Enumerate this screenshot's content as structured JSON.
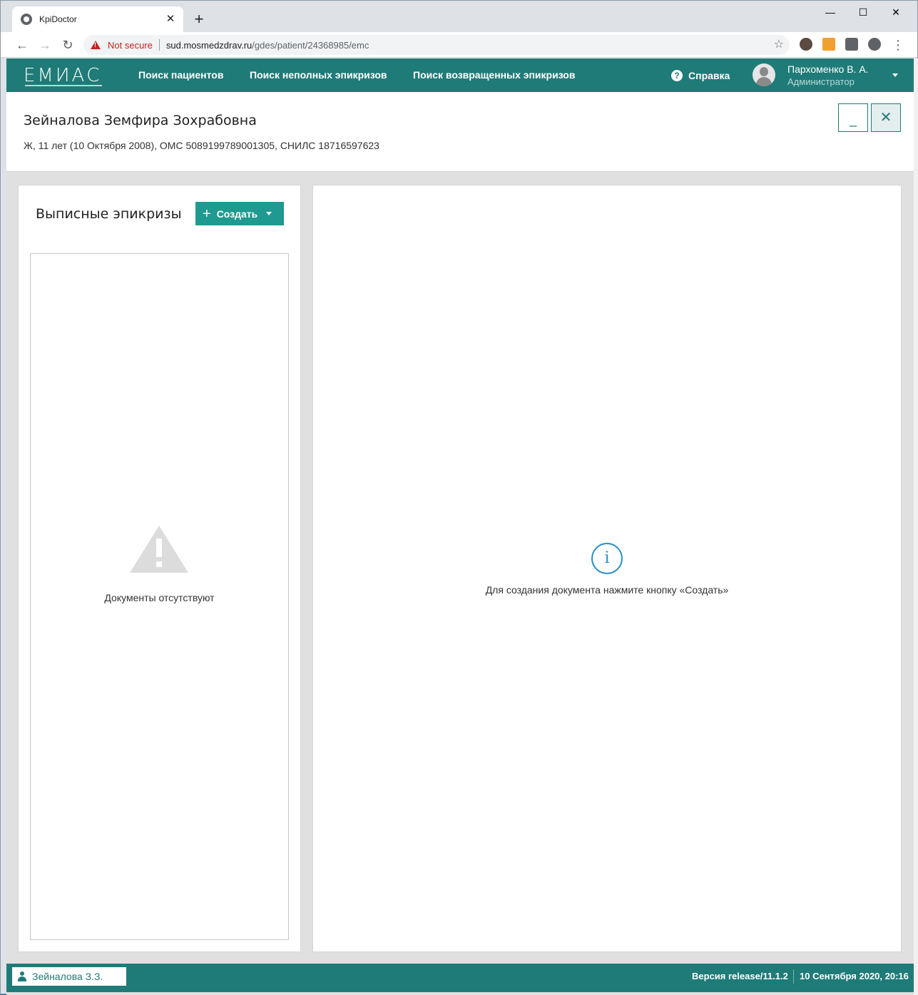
{
  "browser": {
    "tab_title": "KpiDoctor",
    "tab_close": "✕",
    "new_tab": "+",
    "minimize": "—",
    "maximize": "☐",
    "close": "✕",
    "security_label": "Not secure",
    "url_host": "sud.mosmedzdrav.ru",
    "url_path": "/gdes/patient/24368985/emc"
  },
  "appbar": {
    "logo": "ЕМИАС",
    "nav": [
      {
        "label": "Поиск пациентов"
      },
      {
        "label": "Поиск неполных эпикризов"
      },
      {
        "label": "Поиск возвращенных эпикризов"
      }
    ],
    "help_label": "Справка",
    "user_name": "Пархоменко В. А.",
    "user_role": "Администратор",
    "accent_color": "#1f7b78"
  },
  "patient": {
    "name": "Зейналова Земфира Зохрабовна",
    "info": "Ж, 11 лет (10 Октября 2008), ОМС 5089199789001305, СНИЛС 18716597623",
    "minimize_label": "_",
    "close_label": "✕"
  },
  "left_panel": {
    "title": "Выписные эпикризы",
    "create_label": "Создать",
    "empty_text": "Документы отсутствуют"
  },
  "right_panel": {
    "info_glyph": "i",
    "hint": "Для создания документа нажмите кнопку «Создать»"
  },
  "footer": {
    "patient_tab": "Зейналова З.З.",
    "version": "Версия release/11.1.2",
    "datetime": "10 Сентября 2020, 20:16"
  }
}
